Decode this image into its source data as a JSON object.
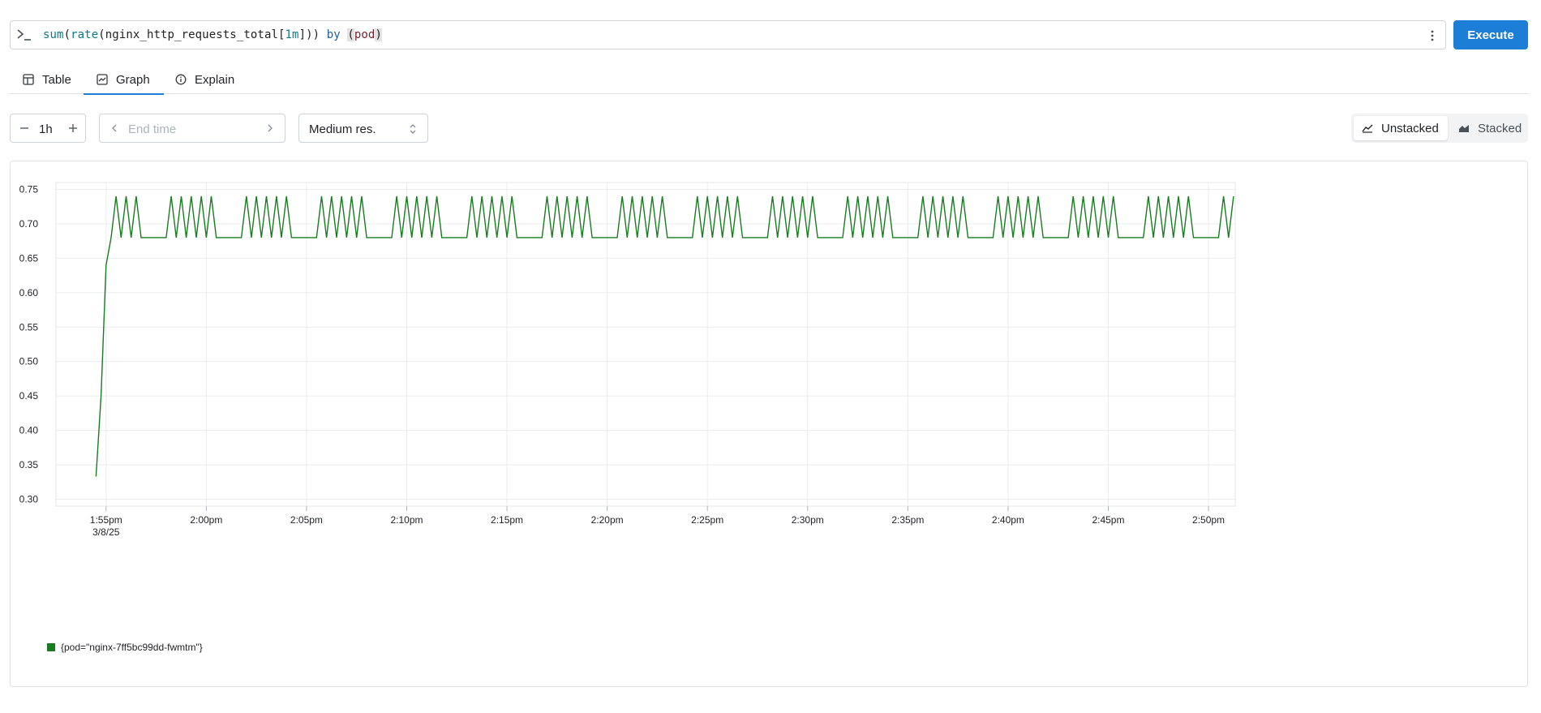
{
  "query": {
    "parts": [
      {
        "text": "sum",
        "cls": "q-fn"
      },
      {
        "text": "(",
        "cls": ""
      },
      {
        "text": "rate",
        "cls": "q-fn"
      },
      {
        "text": "(",
        "cls": ""
      },
      {
        "text": "nginx_http_requests_total",
        "cls": "q-metric"
      },
      {
        "text": "[",
        "cls": ""
      },
      {
        "text": "1m",
        "cls": "q-num"
      },
      {
        "text": "])) ",
        "cls": ""
      },
      {
        "text": "by",
        "cls": "q-kw"
      },
      {
        "text": " ",
        "cls": ""
      },
      {
        "text": "(",
        "cls": "q-paren-hl"
      },
      {
        "text": "pod",
        "cls": "q-label"
      },
      {
        "text": ")",
        "cls": "q-paren-hl"
      }
    ],
    "execute_label": "Execute"
  },
  "tabs": {
    "table": "Table",
    "graph": "Graph",
    "explain": "Explain"
  },
  "controls": {
    "range": "1h",
    "end_time_placeholder": "End time",
    "resolution": "Medium res.",
    "unstacked": "Unstacked",
    "stacked": "Stacked"
  },
  "colors": {
    "accent": "#1c7ed6",
    "series": "#177d1e"
  },
  "chart_data": {
    "type": "line",
    "title": "",
    "xlabel": "",
    "ylabel": "",
    "ylim": [
      0.29,
      0.76
    ],
    "xlim": [
      "13:52:30",
      "14:51:20"
    ],
    "yticks": [
      "0.30",
      "0.35",
      "0.40",
      "0.45",
      "0.50",
      "0.55",
      "0.60",
      "0.65",
      "0.70",
      "0.75"
    ],
    "xticks": [
      {
        "time": "13:55",
        "label": "1:55pm",
        "sublabel": "3/8/25"
      },
      {
        "time": "14:00",
        "label": "2:00pm"
      },
      {
        "time": "14:05",
        "label": "2:05pm"
      },
      {
        "time": "14:10",
        "label": "2:10pm"
      },
      {
        "time": "14:15",
        "label": "2:15pm"
      },
      {
        "time": "14:20",
        "label": "2:20pm"
      },
      {
        "time": "14:25",
        "label": "2:25pm"
      },
      {
        "time": "14:30",
        "label": "2:30pm"
      },
      {
        "time": "14:35",
        "label": "2:35pm"
      },
      {
        "time": "14:40",
        "label": "2:40pm"
      },
      {
        "time": "14:45",
        "label": "2:45pm"
      },
      {
        "time": "14:50",
        "label": "2:50pm"
      }
    ],
    "grid": true,
    "legend_position": "bottom-left",
    "series": [
      {
        "name": "{pod=\"nginx-7ff5bc99dd-fwmtm\"}",
        "color": "#177d1e",
        "start_time": "13:55",
        "interval_seconds": 15,
        "leading": [
          {
            "time": "13:54:30",
            "value": 0.333
          },
          {
            "time": "13:54:45",
            "value": 0.45
          },
          {
            "time": "13:55:00",
            "value": 0.64
          }
        ],
        "values": [
          0.68,
          0.74,
          0.68,
          0.74,
          0.68,
          0.74,
          0.68,
          0.68,
          0.68,
          0.68,
          0.68,
          0.68,
          0.74,
          0.68,
          0.74,
          0.68,
          0.74,
          0.68,
          0.74,
          0.68,
          0.74,
          0.68,
          0.68,
          0.68,
          0.68,
          0.68,
          0.68,
          0.74,
          0.68,
          0.74,
          0.68,
          0.74,
          0.68,
          0.74,
          0.68,
          0.74,
          0.68,
          0.68,
          0.68,
          0.68,
          0.68,
          0.68,
          0.74,
          0.68,
          0.74,
          0.68,
          0.74,
          0.68,
          0.74,
          0.68,
          0.74,
          0.68,
          0.68,
          0.68,
          0.68,
          0.68,
          0.68,
          0.74,
          0.68,
          0.74,
          0.68,
          0.74,
          0.68,
          0.74,
          0.68,
          0.74,
          0.68,
          0.68,
          0.68,
          0.68,
          0.68,
          0.68,
          0.74,
          0.68,
          0.74,
          0.68,
          0.74,
          0.68,
          0.74,
          0.68,
          0.74,
          0.68,
          0.68,
          0.68,
          0.68,
          0.68,
          0.68,
          0.74,
          0.68,
          0.74,
          0.68,
          0.74,
          0.68,
          0.74,
          0.68,
          0.74,
          0.68,
          0.68,
          0.68,
          0.68,
          0.68,
          0.68,
          0.74,
          0.68,
          0.74,
          0.68,
          0.74,
          0.68,
          0.74,
          0.68,
          0.74,
          0.68,
          0.68,
          0.68,
          0.68,
          0.68,
          0.68,
          0.74,
          0.68,
          0.74,
          0.68,
          0.74,
          0.68,
          0.74,
          0.68,
          0.74,
          0.68,
          0.68,
          0.68,
          0.68,
          0.68,
          0.68,
          0.74,
          0.68,
          0.74,
          0.68,
          0.74,
          0.68,
          0.74,
          0.68,
          0.74,
          0.68,
          0.68,
          0.68,
          0.68,
          0.68,
          0.68,
          0.74,
          0.68,
          0.74,
          0.68,
          0.74,
          0.68,
          0.74,
          0.68,
          0.74,
          0.68,
          0.68,
          0.68,
          0.68,
          0.68,
          0.68,
          0.74,
          0.68,
          0.74,
          0.68,
          0.74,
          0.68,
          0.74,
          0.68,
          0.74,
          0.68,
          0.68,
          0.68,
          0.68,
          0.68,
          0.68,
          0.74,
          0.68,
          0.74,
          0.68,
          0.74,
          0.68,
          0.74,
          0.68,
          0.74,
          0.68,
          0.68,
          0.68,
          0.68,
          0.68,
          0.68,
          0.74,
          0.68,
          0.74,
          0.68,
          0.74,
          0.68,
          0.74,
          0.68,
          0.74,
          0.68,
          0.68,
          0.68,
          0.68,
          0.68,
          0.68,
          0.74,
          0.68,
          0.74,
          0.68,
          0.74,
          0.68,
          0.74,
          0.68,
          0.74,
          0.68,
          0.68,
          0.68,
          0.68,
          0.68,
          0.68,
          0.74,
          0.68,
          0.74,
          0.68,
          0.74,
          0.68,
          0.74,
          0.68,
          0.74,
          0.68,
          0.68,
          0.68,
          0.68,
          0.68,
          0.68,
          0.74,
          0.68,
          0.74,
          0.68,
          0.74,
          0.68,
          0.74,
          0.68,
          0.74,
          0.68,
          0.68,
          0.68,
          0.68,
          0.68,
          0.68,
          0.74,
          0.68,
          0.74,
          0.68,
          0.74,
          0.68,
          0.74,
          0.68,
          0.74,
          0.68,
          0.68,
          0.68,
          0.68,
          0.68,
          0.68,
          0.74,
          0.68,
          0.74,
          0.68,
          0.74,
          0.68,
          0.74,
          0.68,
          0.74,
          0.68,
          0.68,
          0.68,
          0.68,
          0.68,
          0.68,
          0.74,
          0.68,
          0.74,
          0.68,
          0.74,
          0.68,
          0.74,
          0.68,
          0.74,
          0.68,
          0.68,
          0.68,
          0.68,
          0.68,
          0.68,
          0.74,
          0.68,
          0.74,
          0.68,
          0.74,
          0.68,
          0.74,
          0.68
        ]
      }
    ]
  }
}
